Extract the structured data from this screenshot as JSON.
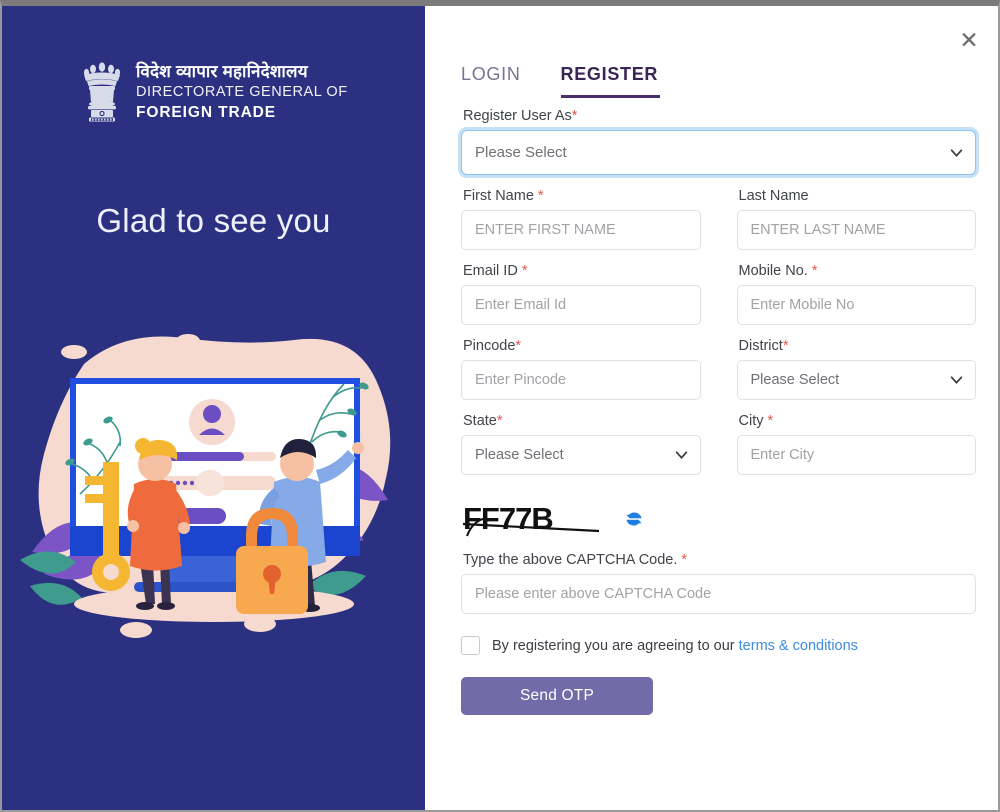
{
  "window": {
    "close_label": "✕"
  },
  "brand": {
    "emblem_icon": "india-national-emblem-icon",
    "hindi_title": "विदेश व्यापार महानिदेशालय",
    "line1": "DIRECTORATE GENERAL OF",
    "line2": "FOREIGN TRADE"
  },
  "left": {
    "heading": "Glad to see you",
    "illustration_name": "secure-login-illustration",
    "bg_color": "#2b3180"
  },
  "tabs": [
    {
      "label": "LOGIN",
      "active": false
    },
    {
      "label": "REGISTER",
      "active": true
    }
  ],
  "form": {
    "register_user_as": {
      "label": "Register User As",
      "required": true,
      "value": "Please Select"
    },
    "first_name": {
      "label": "First Name ",
      "required": true,
      "placeholder": "ENTER FIRST NAME",
      "value": ""
    },
    "last_name": {
      "label": "Last Name",
      "required": false,
      "placeholder": "ENTER LAST NAME",
      "value": ""
    },
    "email": {
      "label": "Email ID ",
      "required": true,
      "placeholder": "Enter Email Id",
      "value": ""
    },
    "mobile": {
      "label": "Mobile No. ",
      "required": true,
      "placeholder": "Enter Mobile No",
      "value": ""
    },
    "pincode": {
      "label": "Pincode",
      "required": true,
      "placeholder": "Enter Pincode",
      "value": ""
    },
    "district": {
      "label": "District",
      "required": true,
      "value": "Please Select"
    },
    "state": {
      "label": "State",
      "required": true,
      "value": "Please Select"
    },
    "city": {
      "label": "City ",
      "required": true,
      "placeholder": "Enter City",
      "value": ""
    },
    "captcha": {
      "code_text": "FF77B",
      "refresh_icon": "refresh-icon",
      "label": "Type the above CAPTCHA Code. ",
      "required": true,
      "placeholder": "Please enter above CAPTCHA Code",
      "value": ""
    },
    "terms": {
      "checked": false,
      "text": "By registering you are agreeing to our ",
      "link_label": "terms & conditions"
    },
    "submit_label": "Send OTP"
  },
  "colors": {
    "brand_blue": "#2b3180",
    "tab_active": "#3a2556",
    "tab_inactive": "#7b7191",
    "required_star": "#e8574c",
    "link_blue": "#3d8ae0",
    "button_purple": "#716ca9",
    "focus_blue": "#8ec2ef"
  }
}
